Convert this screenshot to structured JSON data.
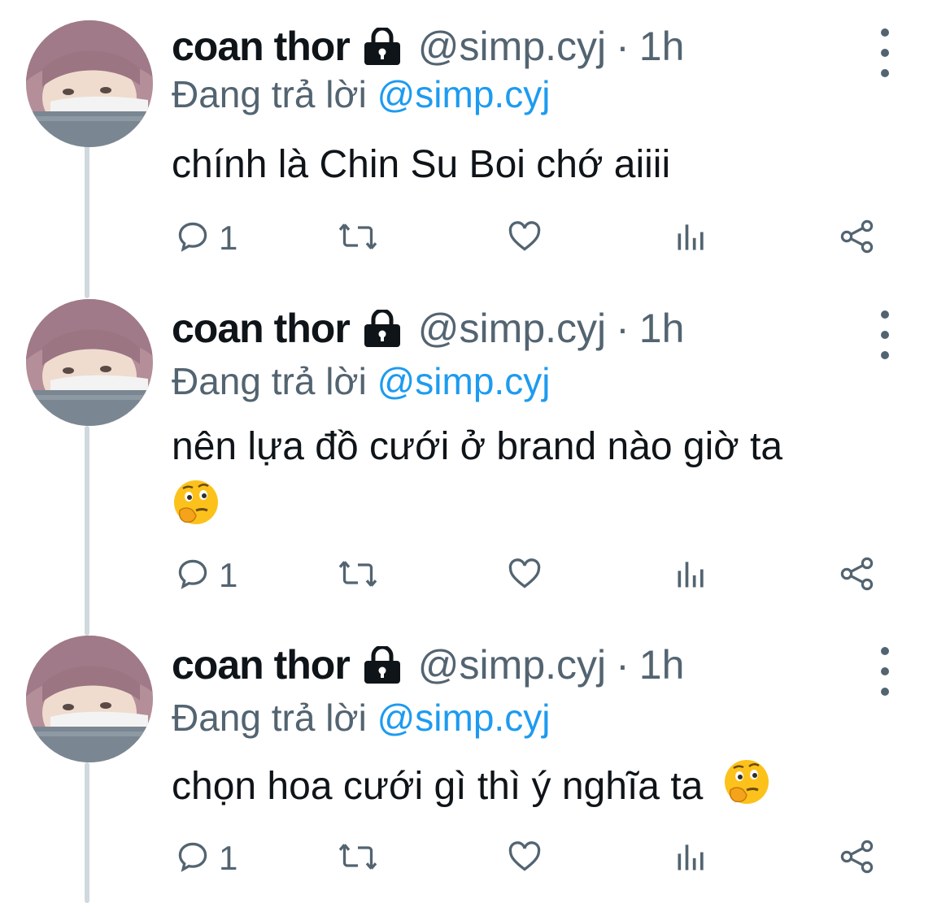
{
  "tweets": [
    {
      "name": "coan thor",
      "handle": "@simp.cyj",
      "separator": "·",
      "time": "1h",
      "replying_prefix": "Đang trả lời",
      "replying_to": "@simp.cyj",
      "text": "chính là Chin Su Boi chớ aiiii",
      "has_emoji": false,
      "reply_count": "1"
    },
    {
      "name": "coan thor",
      "handle": "@simp.cyj",
      "separator": "·",
      "time": "1h",
      "replying_prefix": "Đang trả lời",
      "replying_to": "@simp.cyj",
      "text": "nên lựa đồ cưới ở brand nào giờ ta",
      "has_emoji": true,
      "reply_count": "1"
    },
    {
      "name": "coan thor",
      "handle": "@simp.cyj",
      "separator": "·",
      "time": "1h",
      "replying_prefix": "Đang trả lời",
      "replying_to": "@simp.cyj",
      "text": "chọn hoa cưới gì thì ý nghĩa ta",
      "has_emoji": true,
      "reply_count": "1"
    }
  ],
  "icons": {
    "lock": "lock-icon",
    "more": "more-vertical-icon",
    "reply": "reply-icon",
    "retweet": "retweet-icon",
    "like": "heart-icon",
    "views": "views-icon",
    "share": "share-icon",
    "emoji": "thinking-face-emoji"
  },
  "colors": {
    "text": "#0f1419",
    "secondary": "#536471",
    "link": "#1d9bf0",
    "thread_line": "#cfd9de"
  }
}
